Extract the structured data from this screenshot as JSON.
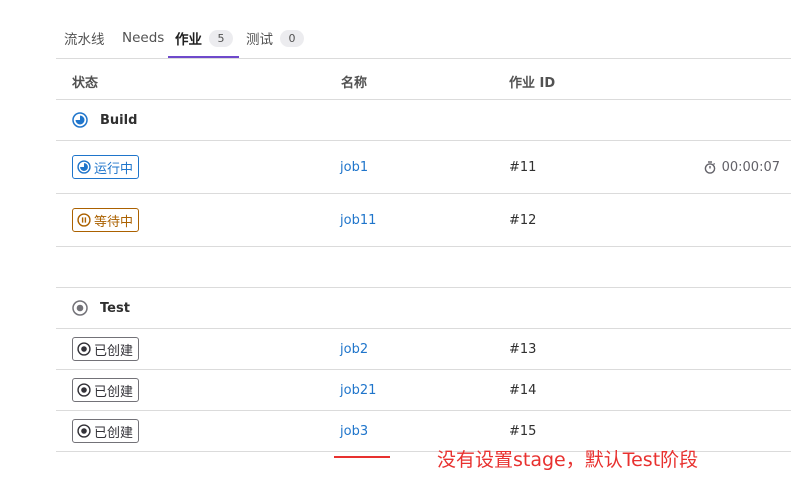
{
  "tabs": [
    {
      "label": "流水线"
    },
    {
      "label": "Needs"
    },
    {
      "label": "作业",
      "count": "5"
    },
    {
      "label": "测试",
      "count": "0"
    }
  ],
  "table": {
    "headers": {
      "status": "状态",
      "name": "名称",
      "id": "作业 ID"
    }
  },
  "stages": [
    {
      "name": "Build",
      "status_icon": "running-status-icon",
      "jobs": [
        {
          "status": "运行中",
          "status_icon": "running-status-icon",
          "name": "job1",
          "id": "#11",
          "duration": "00:00:07",
          "duration_icon": "timer-icon"
        },
        {
          "status": "等待中",
          "status_icon": "pending-status-icon",
          "name": "job11",
          "id": "#12"
        }
      ]
    },
    {
      "name": "Test",
      "status_icon": "created-status-icon",
      "jobs": [
        {
          "status": "已创建",
          "status_icon": "created-status-icon",
          "name": "job2",
          "id": "#13"
        },
        {
          "status": "已创建",
          "status_icon": "created-status-icon",
          "name": "job21",
          "id": "#14"
        },
        {
          "status": "已创建",
          "status_icon": "created-status-icon",
          "name": "job3",
          "id": "#15"
        }
      ]
    }
  ],
  "annotation": {
    "text": "没有设置stage，默认Test阶段"
  },
  "colors": {
    "running": "#1f75cb",
    "pending": "#ab6100",
    "created": "#737278",
    "tab_active_underline": "#6e49cb",
    "annotation": "#e8312f"
  }
}
